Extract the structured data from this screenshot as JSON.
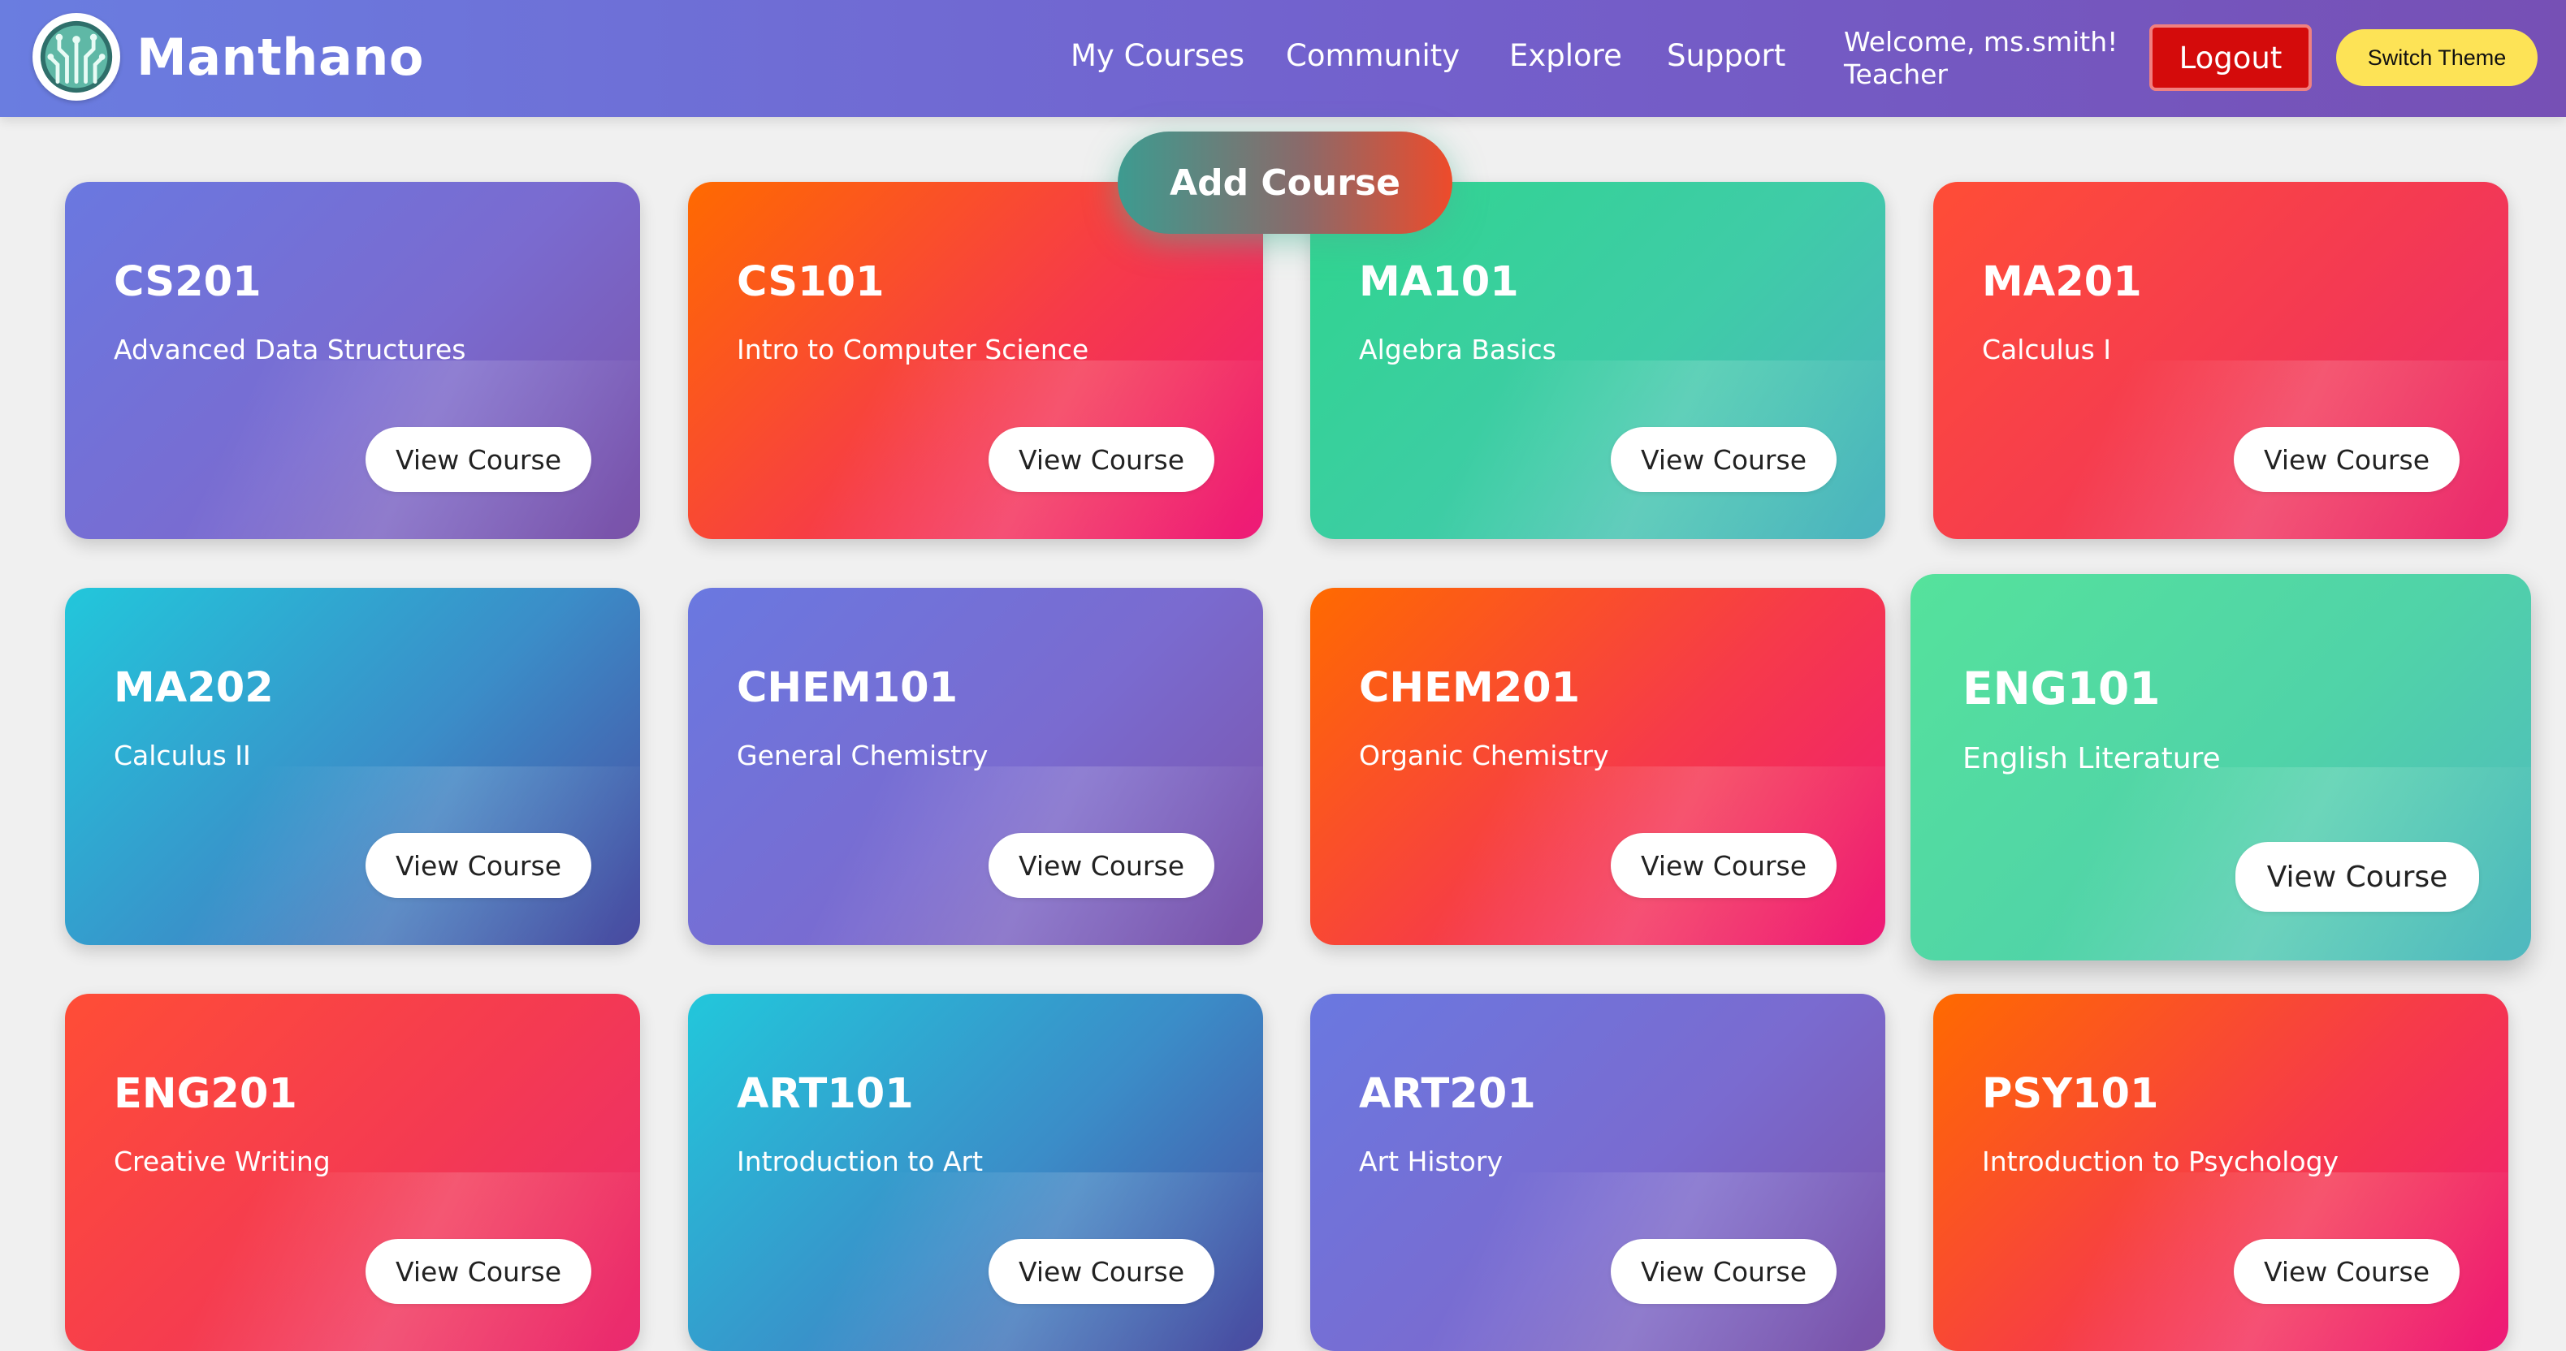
{
  "header": {
    "brand": "Manthano",
    "nav": [
      "My Courses",
      "Community",
      "Explore",
      "Support"
    ],
    "welcome_line1": "Welcome, ms.smith!",
    "welcome_line2": "Teacher",
    "logout_label": "Logout",
    "theme_label": "Switch Theme",
    "logo_icon": "circuit-tree-logo-icon"
  },
  "main": {
    "add_course_label": "Add Course",
    "view_label": "View Course",
    "courses": [
      {
        "code": "CS201",
        "title": "Advanced Data Structures"
      },
      {
        "code": "CS101",
        "title": "Intro to Computer Science"
      },
      {
        "code": "MA101",
        "title": "Algebra Basics"
      },
      {
        "code": "MA201",
        "title": "Calculus I"
      },
      {
        "code": "MA202",
        "title": "Calculus II"
      },
      {
        "code": "CHEM101",
        "title": "General Chemistry"
      },
      {
        "code": "CHEM201",
        "title": "Organic Chemistry"
      },
      {
        "code": "ENG101",
        "title": "English Literature"
      },
      {
        "code": "ENG201",
        "title": "Creative Writing"
      },
      {
        "code": "ART101",
        "title": "Introduction to Art"
      },
      {
        "code": "ART201",
        "title": "Art History"
      },
      {
        "code": "PSY101",
        "title": "Introduction to Psychology"
      }
    ]
  },
  "colors": {
    "navbar": "#7360cc",
    "logout": "#d40b0b",
    "switch_theme": "#fde356",
    "background": "#f0f0f0"
  }
}
